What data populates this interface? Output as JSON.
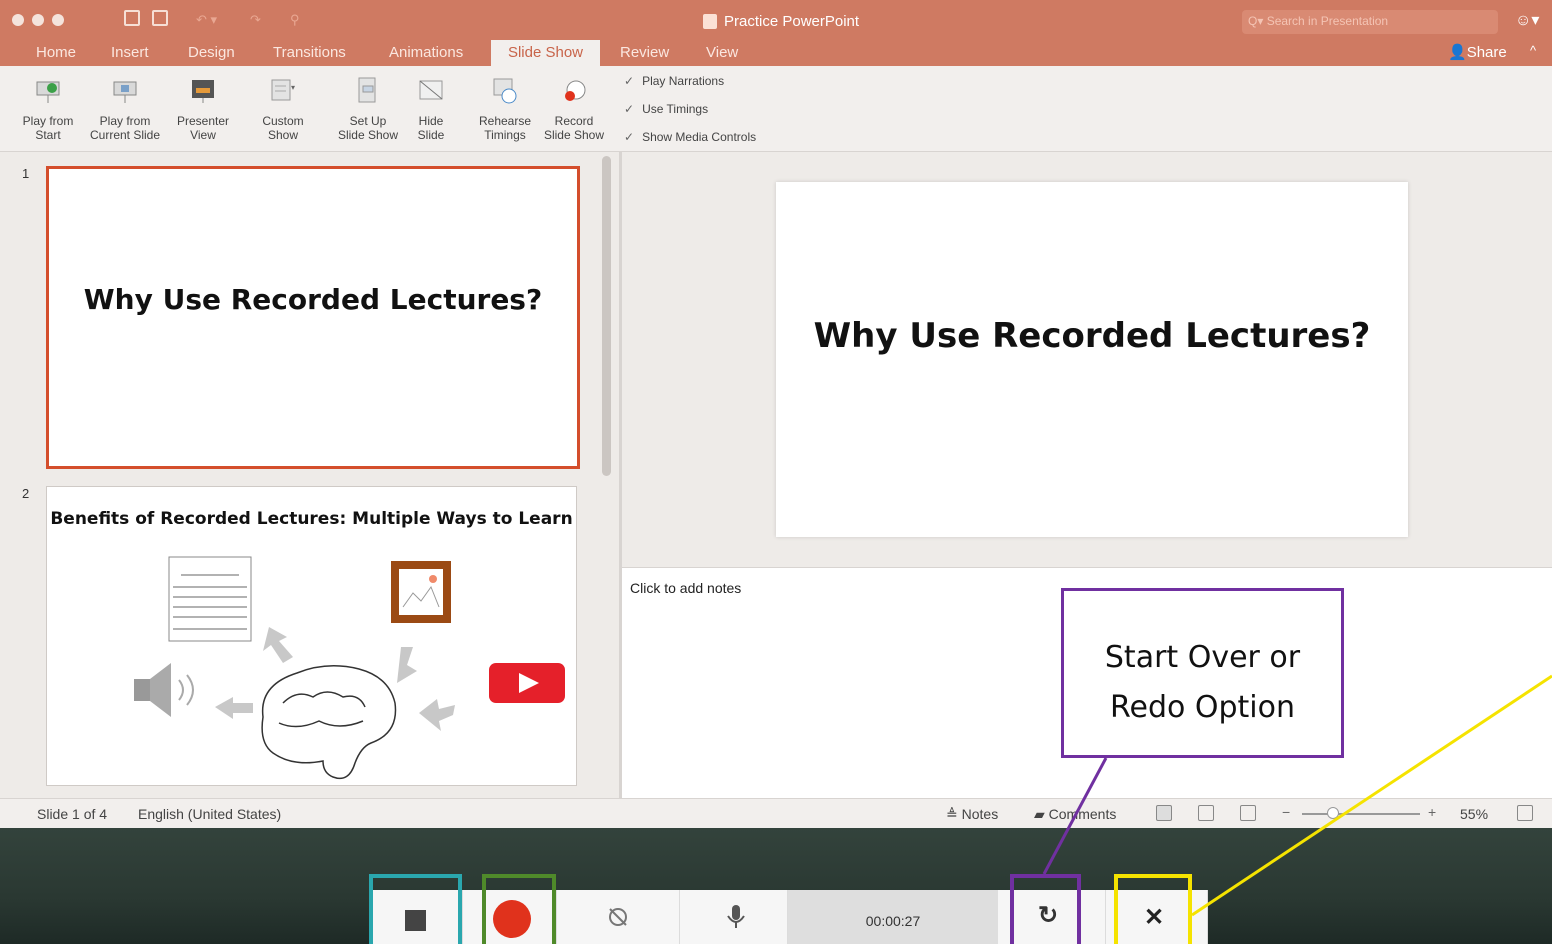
{
  "window": {
    "title": "Practice PowerPoint",
    "search_placeholder": "Search in Presentation",
    "share_label": "Share"
  },
  "tabs": [
    "Home",
    "Insert",
    "Design",
    "Transitions",
    "Animations",
    "Slide Show",
    "Review",
    "View"
  ],
  "active_tab": "Slide Show",
  "ribbon": {
    "buttons": [
      {
        "line1": "Play from",
        "line2": "Start",
        "icon": "play-from-start-icon"
      },
      {
        "line1": "Play from",
        "line2": "Current Slide",
        "icon": "play-from-current-icon"
      },
      {
        "line1": "Presenter",
        "line2": "View",
        "icon": "presenter-view-icon"
      },
      {
        "line1": "Custom",
        "line2": "Show",
        "icon": "custom-show-icon"
      },
      {
        "line1": "Set Up",
        "line2": "Slide Show",
        "icon": "setup-slideshow-icon"
      },
      {
        "line1": "Hide",
        "line2": "Slide",
        "icon": "hide-slide-icon"
      },
      {
        "line1": "Rehearse",
        "line2": "Timings",
        "icon": "rehearse-timings-icon"
      },
      {
        "line1": "Record",
        "line2": "Slide Show",
        "icon": "record-slideshow-icon"
      }
    ],
    "checkboxes": [
      "Play Narrations",
      "Use Timings",
      "Show Media Controls"
    ]
  },
  "slides": {
    "numbers": [
      "1",
      "2"
    ],
    "slide1_title": "Why Use Recorded Lectures?",
    "slide2_title": "Benefits of Recorded Lectures: Multiple Ways to Learn"
  },
  "main_slide_title": "Why Use Recorded Lectures?",
  "notes_placeholder": "Click to add notes",
  "status": {
    "slide_count": "Slide 1 of 4",
    "language": "English (United States)",
    "notes_label": "Notes",
    "comments_label": "Comments",
    "zoom": "55%",
    "zoom_minus": "−",
    "zoom_plus": "+"
  },
  "recording": {
    "timer": "00:00:27"
  },
  "callout": {
    "line1": "Start Over or",
    "line2": "Redo Option"
  },
  "colors": {
    "titlebar": "#cf7a62",
    "accent": "#d44e2c",
    "record_red": "#e0321c",
    "highlight_teal": "#2aa7ae",
    "highlight_green": "#4f8a2a",
    "highlight_purple": "#7030a0",
    "highlight_yellow": "#f5e300"
  }
}
